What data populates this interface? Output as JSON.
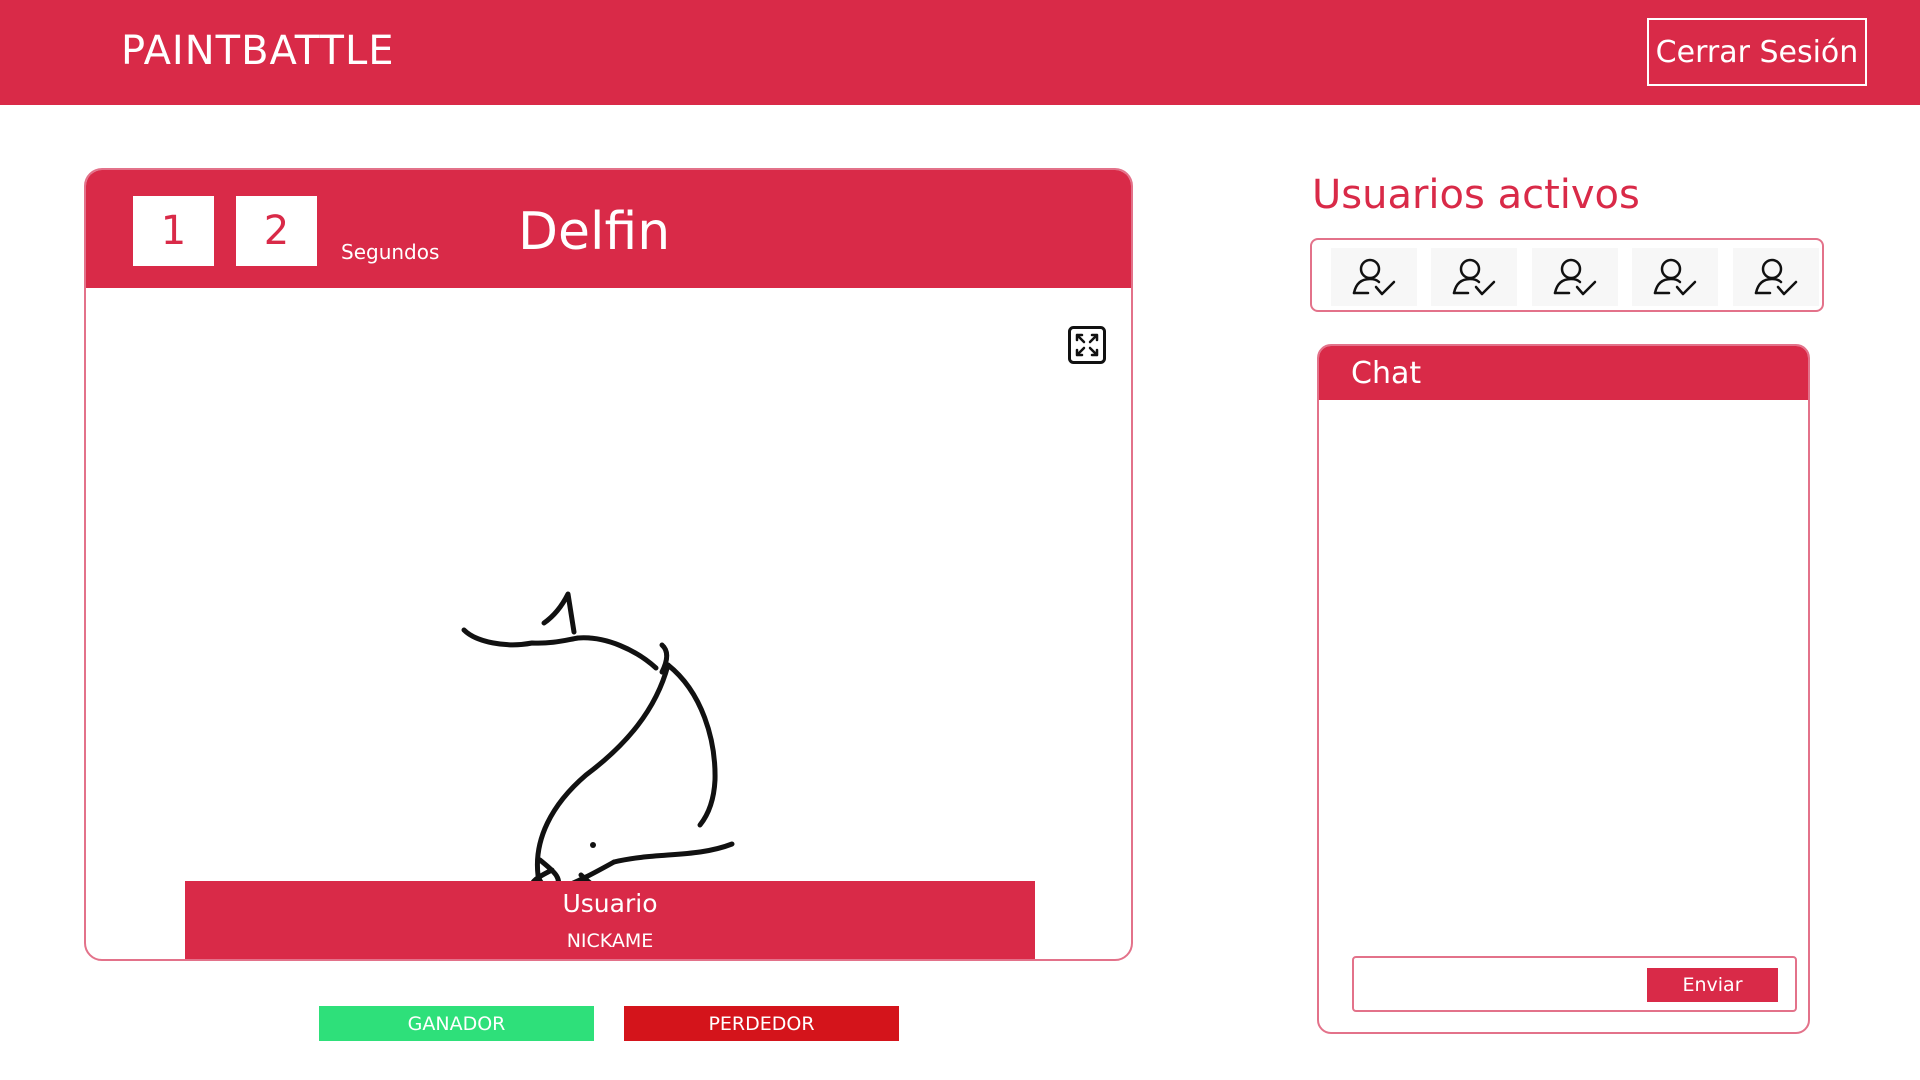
{
  "header": {
    "brand": "PAINTBATTLE",
    "logout_label": "Cerrar Sesión"
  },
  "game": {
    "timer_digits": [
      "1",
      "2"
    ],
    "timer_unit": "Segundos",
    "word": "Delfin",
    "expand_icon": "expand-icon",
    "drawing_subject": "dolphin-sketch",
    "user_label": "Usuario",
    "user_nick": "NICKAME",
    "winner_label": "GANADOR",
    "loser_label": "PERDEDOR"
  },
  "active_users": {
    "title": "Usuarios activos",
    "icon": "user-check-icon",
    "count": 5
  },
  "chat": {
    "title": "Chat",
    "input_value": "",
    "send_label": "Enviar"
  },
  "colors": {
    "accent": "#d92a48",
    "winner": "#2ee07a",
    "loser": "#d4141b",
    "border": "#e3728a"
  }
}
